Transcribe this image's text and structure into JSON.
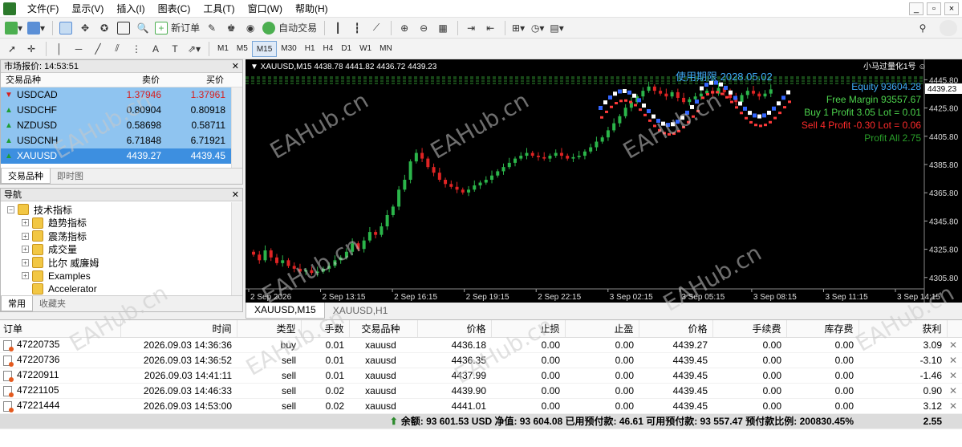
{
  "menu": [
    "文件(F)",
    "显示(V)",
    "插入(I)",
    "图表(C)",
    "工具(T)",
    "窗口(W)",
    "帮助(H)"
  ],
  "toolbar": {
    "new_order": "新订单",
    "auto_trading": "自动交易"
  },
  "timeframes": [
    "M1",
    "M5",
    "M15",
    "M30",
    "H1",
    "H4",
    "D1",
    "W1",
    "MN"
  ],
  "active_timeframe": "M15",
  "market_watch": {
    "title": "市场报价: 14:53:51",
    "columns": [
      "交易品种",
      "卖价",
      "买价"
    ],
    "rows": [
      {
        "symbol": "USDCAD",
        "bid": "1.37946",
        "ask": "1.37961",
        "bg": "#8fc4f0",
        "dir": "down"
      },
      {
        "symbol": "USDCHF",
        "bid": "0.80904",
        "ask": "0.80918",
        "bg": "#8fc4f0",
        "dir": "up"
      },
      {
        "symbol": "NZDUSD",
        "bid": "0.58698",
        "ask": "0.58711",
        "bg": "#8fc4f0",
        "dir": "up"
      },
      {
        "symbol": "USDCNH",
        "bid": "6.71848",
        "ask": "6.71921",
        "bg": "#8fc4f0",
        "dir": "up"
      },
      {
        "symbol": "XAUUSD",
        "bid": "4439.27",
        "ask": "4439.45",
        "bg": "#3d8fe0",
        "dir": "up"
      }
    ],
    "tabs": [
      "交易品种",
      "即时图"
    ]
  },
  "navigator": {
    "title": "导航",
    "root": "技术指标",
    "items": [
      "趋势指标",
      "震荡指标",
      "成交量",
      "比尔 威廉姆",
      "Examples",
      "Accelerator"
    ],
    "tabs": [
      "常用",
      "收藏夹"
    ]
  },
  "chart": {
    "header": "XAUUSD,M15  4438.78 4441.82 4436.72 4439.23",
    "top_right_label": "小马过量化1号",
    "info_lines": [
      "Equity 93604.28",
      "Free Margin 93557.67",
      "Buy 1   Profit 3.05  Lot = 0.01",
      "Sell 4   Profit -0.30  Lot = 0.06",
      "Profit All 2.75"
    ],
    "info_colors": [
      "#3fa9f5",
      "#4cd24c",
      "#4cd24c",
      "#ff2b2b",
      "#2aa02a"
    ],
    "prices": [
      "4445.80",
      "4425.80",
      "4405.80",
      "4385.80",
      "4365.80",
      "4345.80",
      "4325.80",
      "4305.80"
    ],
    "current_price": "4439.23",
    "times": [
      "2 Sep 2026",
      "2 Sep 13:15",
      "2 Sep 16:15",
      "2 Sep 19:15",
      "2 Sep 22:15",
      "3 Sep 02:15",
      "3 Sep 05:15",
      "3 Sep 08:15",
      "3 Sep 11:15",
      "3 Sep 14:15"
    ],
    "tabs": [
      "XAUUSD,M15",
      "XAUUSD,H1"
    ],
    "overlay_text": "使用期限  2028.05.02",
    "up_color": "#2bb54a",
    "down_color": "#e02424"
  },
  "chart_data": {
    "type": "candlestick",
    "symbol": "XAUUSD",
    "timeframe": "M15",
    "ylim": [
      4300,
      4450
    ],
    "closes": [
      4322,
      4318,
      4325,
      4320,
      4316,
      4318,
      4314,
      4312,
      4310,
      4311,
      4309,
      4310,
      4312,
      4314,
      4318,
      4320,
      4324,
      4330,
      4326,
      4332,
      4338,
      4336,
      4342,
      4350,
      4356,
      4368,
      4375,
      4388,
      4394,
      4390,
      4384,
      4380,
      4375,
      4372,
      4370,
      4368,
      4366,
      4368,
      4371,
      4373,
      4375,
      4378,
      4381,
      4384,
      4387,
      4390,
      4392,
      4394,
      4392,
      4391,
      4390,
      4392,
      4394,
      4392,
      4390,
      4391,
      4392,
      4395,
      4398,
      4402,
      4405,
      4410,
      4415,
      4420,
      4426,
      4430,
      4434,
      4438,
      4441,
      4438,
      4436,
      4434,
      4437,
      4433,
      4430,
      4432,
      4434,
      4436,
      4438,
      4436,
      4440,
      4437,
      4433,
      4430,
      4435,
      4438,
      4436,
      4434,
      4436,
      4439
    ]
  },
  "terminal": {
    "columns": [
      "订单",
      "时间",
      "类型",
      "手数",
      "交易品种",
      "价格",
      "止损",
      "止盈",
      "价格",
      "手续费",
      "库存费",
      "获利"
    ],
    "rows": [
      [
        "47220735",
        "2026.09.03 14:36:36",
        "buy",
        "0.01",
        "xauusd",
        "4436.18",
        "0.00",
        "0.00",
        "4439.27",
        "0.00",
        "0.00",
        "3.09"
      ],
      [
        "47220736",
        "2026.09.03 14:36:52",
        "sell",
        "0.01",
        "xauusd",
        "4436.35",
        "0.00",
        "0.00",
        "4439.45",
        "0.00",
        "0.00",
        "-3.10"
      ],
      [
        "47220911",
        "2026.09.03 14:41:11",
        "sell",
        "0.01",
        "xauusd",
        "4437.99",
        "0.00",
        "0.00",
        "4439.45",
        "0.00",
        "0.00",
        "-1.46"
      ],
      [
        "47221105",
        "2026.09.03 14:46:33",
        "sell",
        "0.02",
        "xauusd",
        "4439.90",
        "0.00",
        "0.00",
        "4439.45",
        "0.00",
        "0.00",
        "0.90"
      ],
      [
        "47221444",
        "2026.09.03 14:53:00",
        "sell",
        "0.02",
        "xauusd",
        "4441.01",
        "0.00",
        "0.00",
        "4439.45",
        "0.00",
        "0.00",
        "3.12"
      ]
    ],
    "summary": "余额: 93 601.53 USD  净值: 93 604.08  已用预付款: 46.61  可用预付款: 93 557.47  预付款比例: 200830.45%",
    "total_profit": "2.55"
  },
  "watermark": "EAHub.cn"
}
